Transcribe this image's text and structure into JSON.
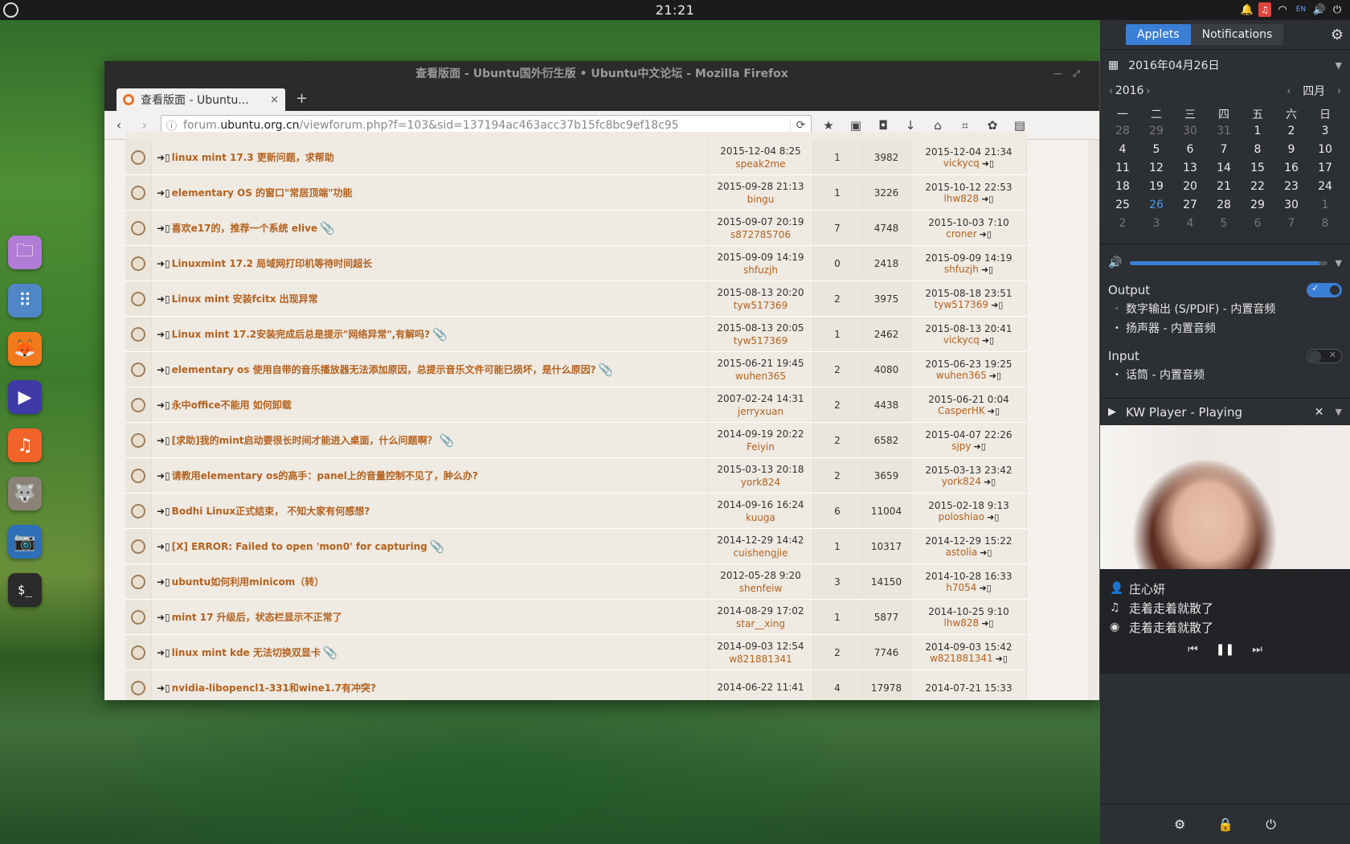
{
  "topbar": {
    "clock": "21:21",
    "tray": [
      {
        "name": "bell-icon",
        "glyph": "🔔"
      },
      {
        "name": "music-indicator-icon",
        "glyph": "♫"
      },
      {
        "name": "wifi-icon",
        "glyph": "◠"
      },
      {
        "name": "keyboard-layout-indicator",
        "glyph": "EN"
      },
      {
        "name": "volume-icon",
        "glyph": "🔊"
      },
      {
        "name": "power-icon",
        "glyph": "⏻"
      }
    ]
  },
  "dock": {
    "apps": [
      {
        "name": "files-app",
        "glyph": "🗀",
        "color": "#b07cd6"
      },
      {
        "name": "app-launcher",
        "glyph": "⠿",
        "color": "#4f86c6"
      },
      {
        "name": "firefox-app",
        "glyph": "🦊",
        "color": "#f07a1c"
      },
      {
        "name": "video-player-app",
        "glyph": "▶",
        "color": "#3f3aa6"
      },
      {
        "name": "music-app",
        "glyph": "♫",
        "color": "#f2632a"
      },
      {
        "name": "gimp-app",
        "glyph": "🐺",
        "color": "#8a8276"
      },
      {
        "name": "screenshot-app",
        "glyph": "📷",
        "color": "#2f6fb8"
      },
      {
        "name": "terminal-app",
        "glyph": "$_",
        "color": "#2a2a2a"
      }
    ]
  },
  "firefox": {
    "window_title": "查看版面 - Ubuntu国外衍生版 • Ubuntu中文论坛 - Mozilla Firefox",
    "tab_title": "查看版面 - Ubuntu...",
    "tab_close": "×",
    "new_tab": "+",
    "url": {
      "prefix": "forum.",
      "host": "ubuntu.org.cn",
      "path": "/viewforum.php?f=103&sid=137194ac463acc37b15fc8bc9ef18c95"
    },
    "rows": [
      {
        "title": "linux mint 17.3 更新问题，求帮助",
        "clip": false,
        "first_date": "2015-12-04 8:25",
        "first_user": "speak2me",
        "replies": "1",
        "views": "3982",
        "last_date": "2015-12-04 21:34",
        "last_user": "vickycq"
      },
      {
        "title": "elementary OS 的窗口\"常居顶端\"功能",
        "clip": false,
        "first_date": "2015-09-28 21:13",
        "first_user": "bingu",
        "replies": "1",
        "views": "3226",
        "last_date": "2015-10-12 22:53",
        "last_user": "lhw828"
      },
      {
        "title": "喜欢e17的，推荐一个系统 elive",
        "clip": true,
        "first_date": "2015-09-07 20:19",
        "first_user": "s872785706",
        "replies": "7",
        "views": "4748",
        "last_date": "2015-10-03 7:10",
        "last_user": "croner"
      },
      {
        "title": "Linuxmint 17.2 局域网打印机等待时间超长",
        "clip": false,
        "first_date": "2015-09-09 14:19",
        "first_user": "shfuzjh",
        "replies": "0",
        "views": "2418",
        "last_date": "2015-09-09 14:19",
        "last_user": "shfuzjh"
      },
      {
        "title": "Linux mint 安装fcitx 出现异常",
        "clip": false,
        "first_date": "2015-08-13 20:20",
        "first_user": "tyw517369",
        "replies": "2",
        "views": "3975",
        "last_date": "2015-08-18 23:51",
        "last_user": "tyw517369"
      },
      {
        "title": "Linux mint 17.2安装完成后总是提示\"网络异常\",有解吗?",
        "clip": true,
        "first_date": "2015-08-13 20:05",
        "first_user": "tyw517369",
        "replies": "1",
        "views": "2462",
        "last_date": "2015-08-13 20:41",
        "last_user": "vickycq"
      },
      {
        "title": "elementary os 使用自带的音乐播放器无法添加原因，总提示音乐文件可能已损坏，是什么原因?",
        "clip": true,
        "first_date": "2015-06-21 19:45",
        "first_user": "wuhen365",
        "replies": "2",
        "views": "4080",
        "last_date": "2015-06-23 19:25",
        "last_user": "wuhen365"
      },
      {
        "title": "永中office不能用 如何卸载",
        "clip": false,
        "first_date": "2007-02-24 14:31",
        "first_user": "jerryxuan",
        "replies": "2",
        "views": "4438",
        "last_date": "2015-06-21 0:04",
        "last_user": "CasperHK"
      },
      {
        "title": "[求助]我的mint启动要很长时间才能进入桌面，什么问题啊？",
        "clip": true,
        "first_date": "2014-09-19 20:22",
        "first_user": "Feiyin",
        "replies": "2",
        "views": "6582",
        "last_date": "2015-04-07 22:26",
        "last_user": "sjpy"
      },
      {
        "title": "请教用elementary os的高手：panel上的音量控制不见了，肿么办?",
        "clip": false,
        "first_date": "2015-03-13 20:18",
        "first_user": "york824",
        "replies": "2",
        "views": "3659",
        "last_date": "2015-03-13 23:42",
        "last_user": "york824"
      },
      {
        "title": "Bodhi Linux正式结束， 不知大家有何感想?",
        "clip": false,
        "first_date": "2014-09-16 16:24",
        "first_user": "kuuga",
        "replies": "6",
        "views": "11004",
        "last_date": "2015-02-18 9:13",
        "last_user": "poloshiao"
      },
      {
        "title": "[X] ERROR: Failed to open 'mon0' for capturing",
        "clip": true,
        "first_date": "2014-12-29 14:42",
        "first_user": "cuishengjie",
        "replies": "1",
        "views": "10317",
        "last_date": "2014-12-29 15:22",
        "last_user": "astolia"
      },
      {
        "title": "ubuntu如何利用minicom（转）",
        "clip": false,
        "first_date": "2012-05-28 9:20",
        "first_user": "shenfeiw",
        "replies": "3",
        "views": "14150",
        "last_date": "2014-10-28 16:33",
        "last_user": "h7054"
      },
      {
        "title": "mint 17 升级后，状态栏显示不正常了",
        "clip": false,
        "first_date": "2014-08-29 17:02",
        "first_user": "star__xing",
        "replies": "1",
        "views": "5877",
        "last_date": "2014-10-25 9:10",
        "last_user": "lhw828"
      },
      {
        "title": "linux mint kde 无法切换双显卡",
        "clip": true,
        "first_date": "2014-09-03 12:54",
        "first_user": "w821881341",
        "replies": "2",
        "views": "7746",
        "last_date": "2014-09-03 15:42",
        "last_user": "w821881341"
      },
      {
        "title": "nvidia-libopencl1-331和wine1.7有冲突?",
        "clip": false,
        "first_date": "2014-06-22 11:41",
        "first_user": "",
        "replies": "4",
        "views": "17978",
        "last_date": "2014-07-21 15:33",
        "last_user": ""
      }
    ]
  },
  "panel": {
    "tabs": {
      "applets": "Applets",
      "notifications": "Notifications"
    },
    "calendar": {
      "header_date": "2016年04月26日",
      "year": "2016",
      "month": "四月",
      "weekdays": [
        "一",
        "二",
        "三",
        "四",
        "五",
        "六",
        "日"
      ],
      "days": [
        [
          "28",
          "29",
          "30",
          "31",
          "1",
          "2",
          "3"
        ],
        [
          "4",
          "5",
          "6",
          "7",
          "8",
          "9",
          "10"
        ],
        [
          "11",
          "12",
          "13",
          "14",
          "15",
          "16",
          "17"
        ],
        [
          "18",
          "19",
          "20",
          "21",
          "22",
          "23",
          "24"
        ],
        [
          "25",
          "26",
          "27",
          "28",
          "29",
          "30",
          "1"
        ],
        [
          "2",
          "3",
          "4",
          "5",
          "6",
          "7",
          "8"
        ]
      ],
      "today": "26"
    },
    "sound": {
      "volume": 0.96,
      "output_label": "Output",
      "output_enabled": true,
      "outputs": [
        "数字输出 (S/PDIF) - 内置音频",
        "扬声器 - 内置音频"
      ],
      "output_selected": 1,
      "input_label": "Input",
      "input_enabled": false,
      "inputs": [
        "话筒 - 内置音频"
      ]
    },
    "player": {
      "title": "KW Player - Playing",
      "artist": "庄心妍",
      "track": "走着走着就散了",
      "album": "走着走着就散了"
    },
    "accent_color": "#3a7fd6"
  }
}
